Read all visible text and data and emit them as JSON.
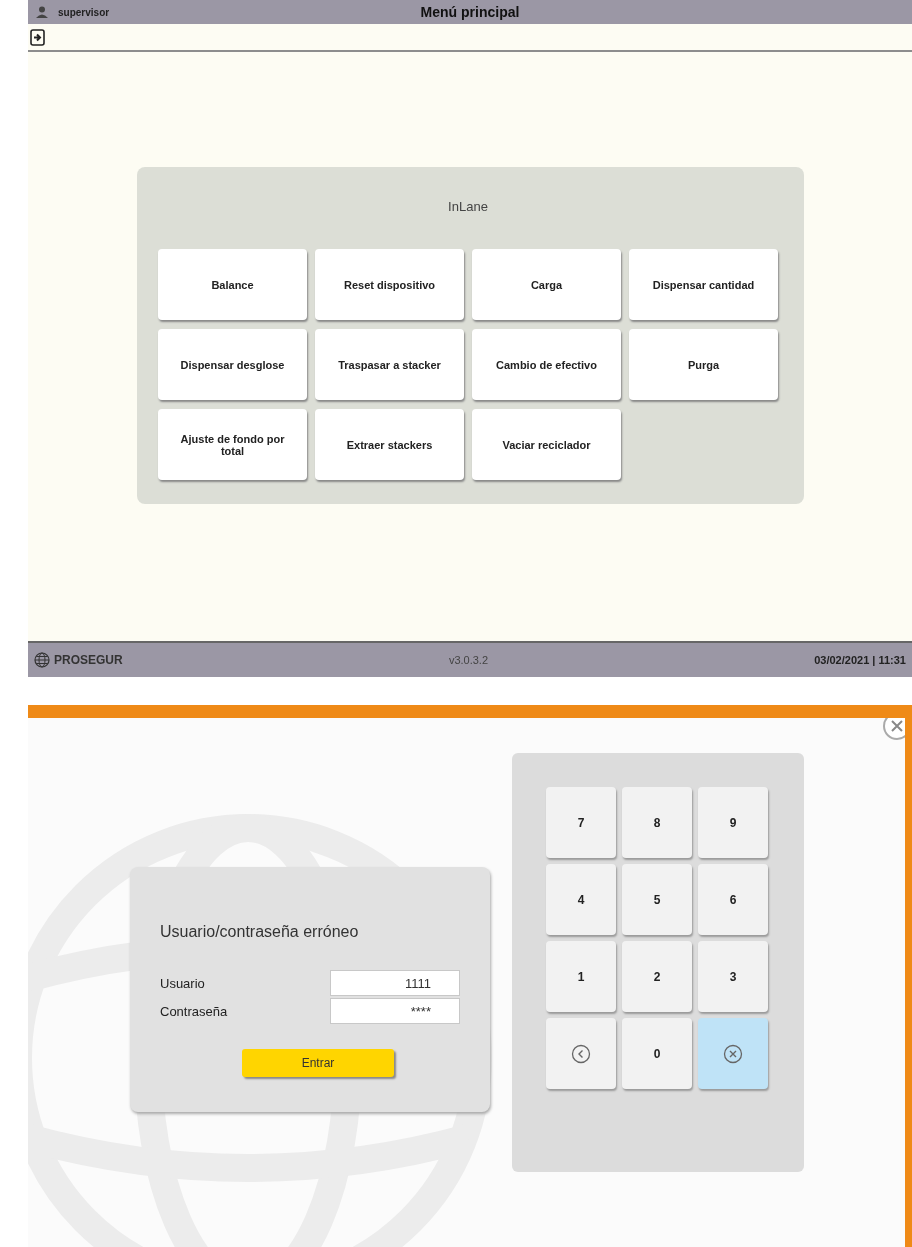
{
  "menu_screen": {
    "header": {
      "user": "supervisor",
      "title": "Menú principal"
    },
    "panel": {
      "title": "InLane",
      "buttons": [
        {
          "label": "Balance"
        },
        {
          "label": "Reset dispositivo"
        },
        {
          "label": "Carga"
        },
        {
          "label": "Dispensar cantidad"
        },
        {
          "label": "Dispensar desglose"
        },
        {
          "label": "Traspasar a stacker"
        },
        {
          "label": "Cambio de efectivo"
        },
        {
          "label": "Purga"
        },
        {
          "label": "Ajuste de fondo por total"
        },
        {
          "label": "Extraer stackers"
        },
        {
          "label": "Vaciar reciclador"
        }
      ]
    },
    "footer": {
      "brand": "PROSEGUR",
      "version": "v3.0.3.2",
      "datetime": "03/02/2021 | 11:31"
    }
  },
  "login_screen": {
    "message": "Usuario/contraseña erróneo",
    "fields": [
      {
        "label": "Usuario",
        "value": "1111"
      },
      {
        "label": "Contraseña",
        "value": "****"
      }
    ],
    "submit": "Entrar",
    "keys": [
      {
        "kind": "digit",
        "label": "7",
        "pressed": false
      },
      {
        "kind": "digit",
        "label": "8",
        "pressed": false
      },
      {
        "kind": "digit",
        "label": "9",
        "pressed": false
      },
      {
        "kind": "digit",
        "label": "4",
        "pressed": false
      },
      {
        "kind": "digit",
        "label": "5",
        "pressed": false
      },
      {
        "kind": "digit",
        "label": "6",
        "pressed": false
      },
      {
        "kind": "digit",
        "label": "1",
        "pressed": false
      },
      {
        "kind": "digit",
        "label": "2",
        "pressed": false
      },
      {
        "kind": "digit",
        "label": "3",
        "pressed": false
      },
      {
        "kind": "back",
        "pressed": false
      },
      {
        "kind": "digit",
        "label": "0",
        "pressed": false
      },
      {
        "kind": "clear",
        "pressed": true
      }
    ]
  }
}
